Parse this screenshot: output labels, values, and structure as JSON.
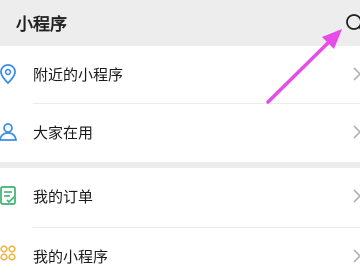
{
  "header": {
    "title": "小程序"
  },
  "sections": [
    {
      "items": [
        {
          "label": "附近的小程序",
          "icon": "location-pin-icon",
          "icon_color": "#3a8ee6"
        },
        {
          "label": "大家在用",
          "icon": "people-icon",
          "icon_color": "#3a8ee6"
        }
      ]
    },
    {
      "items": [
        {
          "label": "我的订单",
          "icon": "order-list-icon",
          "icon_color": "#3cb371"
        },
        {
          "label": "我的小程序",
          "icon": "mini-program-icon",
          "icon_color": "#f0b43c"
        }
      ]
    }
  ],
  "annotation": {
    "arrow_color": "#e84ce8"
  }
}
